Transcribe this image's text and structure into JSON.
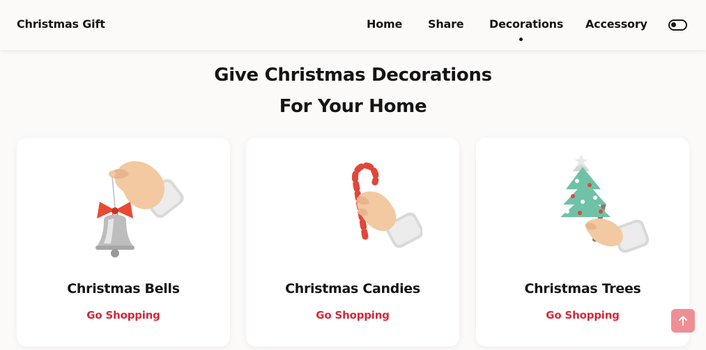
{
  "header": {
    "logo": "Christmas Gift",
    "nav": [
      "Home",
      "Share",
      "Decorations",
      "Accessory"
    ],
    "active_nav": "Decorations",
    "theme_toggle_icon": "toggle-icon"
  },
  "section": {
    "title_line1": "Give Christmas Decorations",
    "title_line2": "For Your Home"
  },
  "cards": [
    {
      "title": "Christmas Bells",
      "link": "Go Shopping",
      "icon": "hand-holding-bell-icon"
    },
    {
      "title": "Christmas Candies",
      "link": "Go Shopping",
      "icon": "hand-holding-candy-cane-icon"
    },
    {
      "title": "Christmas Trees",
      "link": "Go Shopping",
      "icon": "hand-holding-tree-icon"
    }
  ],
  "scroll_up_icon": "arrow-up-icon",
  "colors": {
    "background": "#fcfaf9",
    "accent": "#d5283a",
    "scroll_button": "#ef8e94",
    "text": "#151515"
  }
}
